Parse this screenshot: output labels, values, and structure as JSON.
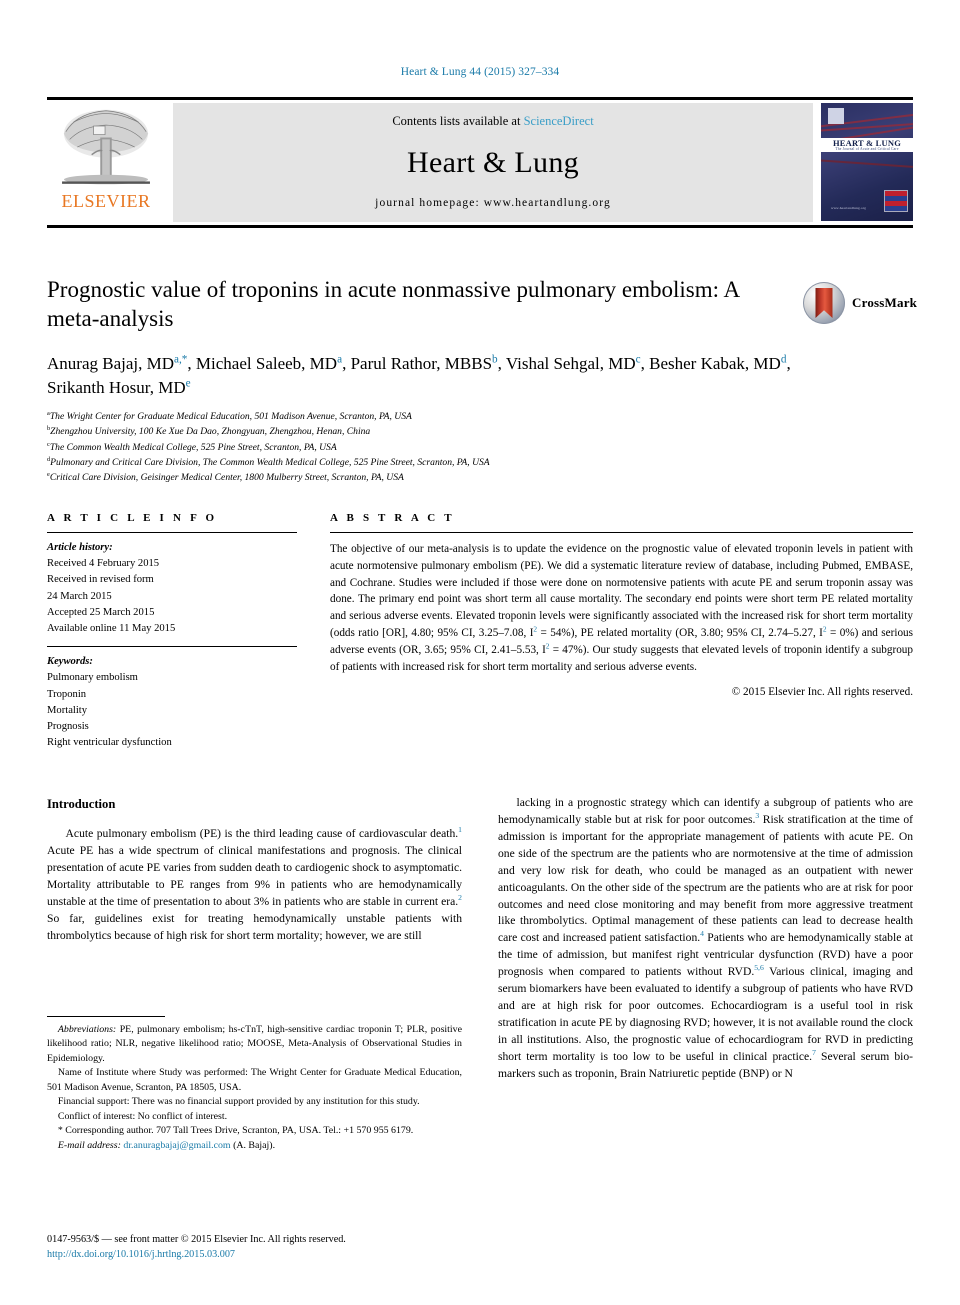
{
  "running_head": "Heart & Lung 44 (2015) 327–334",
  "masthead": {
    "contents_prefix": "Contents lists available at ",
    "sciencedirect": "ScienceDirect",
    "journal_name": "Heart & Lung",
    "homepage": "journal homepage: www.heartandlung.org",
    "publisher_logo_text": "ELSEVIER",
    "cover_title": "HEART & LUNG",
    "cover_subtitle": "The Journal of Acute and Critical Care",
    "cover_url": "www.heartandlung.org"
  },
  "article": {
    "title": "Prognostic value of troponins in acute nonmassive pulmonary embolism: A meta-analysis",
    "crossmark_label": "CrossMark",
    "authors_html": "Anurag Bajaj, MD<sup>a,*</sup>, Michael Saleeb, MD<sup>a</sup>, Parul Rathor, MBBS<sup>b</sup>, Vishal Sehgal, MD<sup>c</sup>, Besher Kabak, MD<sup>d</sup>, Srikanth Hosur, MD<sup>e</sup>",
    "affiliations": [
      {
        "marker": "a",
        "text": "The Wright Center for Graduate Medical Education, 501 Madison Avenue, Scranton, PA, USA"
      },
      {
        "marker": "b",
        "text": "Zhengzhou University, 100 Ke Xue Da Dao, Zhongyuan, Zhengzhou, Henan, China"
      },
      {
        "marker": "c",
        "text": "The Common Wealth Medical College, 525 Pine Street, Scranton, PA, USA"
      },
      {
        "marker": "d",
        "text": "Pulmonary and Critical Care Division, The Common Wealth Medical College, 525 Pine Street, Scranton, PA, USA"
      },
      {
        "marker": "e",
        "text": "Critical Care Division, Geisinger Medical Center, 1800 Mulberry Street, Scranton, PA, USA"
      }
    ]
  },
  "article_info": {
    "heading": "A R T I C L E  I N F O",
    "history_label": "Article history:",
    "history": [
      "Received 4 February 2015",
      "Received in revised form",
      "24 March 2015",
      "Accepted 25 March 2015",
      "Available online 11 May 2015"
    ],
    "keywords_label": "Keywords:",
    "keywords": [
      "Pulmonary embolism",
      "Troponin",
      "Mortality",
      "Prognosis",
      "Right ventricular dysfunction"
    ]
  },
  "abstract": {
    "heading": "A B S T R A C T",
    "body_html": "The objective of our meta-analysis is to update the evidence on the prognostic value of elevated troponin levels in patient with acute normotensive pulmonary embolism (PE). We did a systematic literature review of database, including Pubmed, EMBASE, and Cochrane. Studies were included if those were done on normotensive patients with acute PE and serum troponin assay was done. The primary end point was short term all cause mortality. The secondary end points were short term PE related mortality and serious adverse events. Elevated troponin levels were significantly associated with the increased risk for short term mortality (odds ratio [OR], 4.80; 95% CI, 3.25&ndash;7.08, I<sup>2</sup> = 54%), PE related mortality (OR, 3.80; 95% CI, 2.74&ndash;5.27, I<sup>2</sup> = 0%) and serious adverse events (OR, 3.65; 95% CI, 2.41&ndash;5.53, I<sup>2</sup> = 47%). Our study suggests that elevated levels of troponin identify a subgroup of patients with increased risk for short term mortality and serious adverse events.",
    "copyright": "© 2015 Elsevier Inc. All rights reserved."
  },
  "main": {
    "section_heading": "Introduction",
    "left_paragraph_html": "Acute pulmonary embolism (PE) is the third leading cause of cardiovascular death.<sup>1</sup> Acute PE has a wide spectrum of clinical manifestations and prognosis. The clinical presentation of acute PE varies from sudden death to cardiogenic shock to asymptomatic. Mortality attributable to PE ranges from 9% in patients who are hemodynamically unstable at the time of presentation to about 3% in patients who are stable in current era.<sup>2</sup> So far, guidelines exist for treating hemodynamically unstable patients with thrombolytics because of high risk for short term mortality; however, we are still",
    "right_paragraph_html": "lacking in a prognostic strategy which can identify a subgroup of patients who are hemodynamically stable but at risk for poor outcomes.<sup>3</sup> Risk stratification at the time of admission is important for the appropriate management of patients with acute PE. On one side of the spectrum are the patients who are normotensive at the time of admission and very low risk for death, who could be managed as an outpatient with newer anticoagulants. On the other side of the spectrum are the patients who are at risk for poor outcomes and need close monitoring and may benefit from more aggressive treatment like thrombolytics. Optimal management of these patients can lead to decrease health care cost and increased patient satisfaction.<sup>4</sup> Patients who are hemodynamically stable at the time of admission, but manifest right ventricular dysfunction (RVD) have a poor prognosis when compared to patients without RVD.<sup>5,6</sup> Various clinical, imaging and serum biomarkers have been evaluated to identify a subgroup of patients who have RVD and are at high risk for poor outcomes. Echocardiogram is a useful tool in risk stratification in acute PE by diagnosing RVD; however, it is not available round the clock in all institutions. Also, the prognostic value of echocardiogram for RVD in predicting short term mortality is too low to be useful in clinical practice.<sup>7</sup> Several serum bio-markers such as troponin, Brain Natriuretic peptide (BNP) or N"
  },
  "footnotes": {
    "abbreviations_html": "<span class=\"it\">Abbreviations:</span> PE, pulmonary embolism; hs-cTnT, high-sensitive cardiac troponin T; PLR, positive likelihood ratio; NLR, negative likelihood ratio; MOOSE, Meta-Analysis of Observational Studies in Epidemiology.",
    "institute_html": "Name of Institute where Study was performed: The Wright Center for Graduate Medical Education, 501 Madison Avenue, Scranton, PA 18505, USA.",
    "financial_html": "Financial support: There was no financial support provided by any institution for this study.",
    "conflict_html": "Conflict of interest: No conflict of interest.",
    "corresponding_html": "* Corresponding author. 707 Tall Trees Drive, Scranton, PA, USA. Tel.: +1 570 955 6179.",
    "email_label": "E-mail address:",
    "email": "dr.anuragbajaj@gmail.com",
    "email_suffix": "(A. Bajaj)."
  },
  "issn_line": "0147-9563/$ — see front matter © 2015 Elsevier Inc. All rights reserved.",
  "doi_url": "http://dx.doi.org/10.1016/j.hrtlng.2015.03.007",
  "colors": {
    "link_blue": "#1a7aa8",
    "sciencedirect_blue": "#3a9ec7",
    "elsevier_orange": "#e87722",
    "band_gray": "#e4e4e4"
  }
}
